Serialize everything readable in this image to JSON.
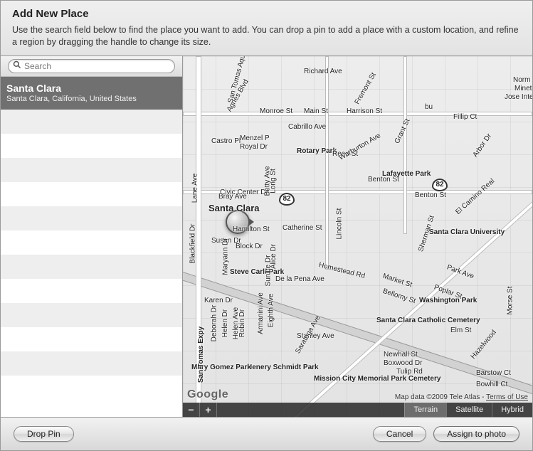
{
  "header": {
    "title": "Add New Place",
    "subtitle": "Use the search field below to find the place you want to add. You can drop a pin to add a place with a custom location, and refine a region by dragging the handle to change its size."
  },
  "search": {
    "placeholder": "Search",
    "value": ""
  },
  "results": [
    {
      "title": "Santa Clara",
      "subtitle": "Santa Clara, California, United States",
      "selected": true
    }
  ],
  "map": {
    "brand": "Google",
    "credit_text": "Map data ©2009 Tele Atlas - ",
    "terms_label": "Terms of Use",
    "zoom_out": "−",
    "zoom_in": "+",
    "types": [
      {
        "label": "Terrain",
        "active": true
      },
      {
        "label": "Satellite",
        "active": false
      },
      {
        "label": "Hybrid",
        "active": false
      }
    ],
    "shields": {
      "hwy_82a": "82",
      "hwy_82b": "82"
    },
    "labels": {
      "santa_clara": "Santa Clara",
      "monroe_st": "Monroe St",
      "main_st": "Main St",
      "richard_ave": "Richard Ave",
      "harrison_st": "Harrison St",
      "cabrillo_ave": "Cabrillo Ave",
      "castro_pl": "Castro Pl",
      "menzel_p": "Menzel P",
      "royal_dr": "Royal Dr",
      "rotary_park": "Rotary Park",
      "reed_st": "Reed St",
      "warburton_ave": "Warburton Ave",
      "benton_st_a": "Benton St",
      "benton_st_b": "Benton St",
      "lafayette_park": "Lafayette Park",
      "civic_center_dr": "Civic Center Dr",
      "catherine_st": "Catherine St",
      "hamilton_st": "Hamilton St",
      "susan_dr": "Susan Dr",
      "block_dr": "Block Dr",
      "bray_ave": "Bray Ave",
      "steve_carli_park": "Steve Carli Park",
      "karen_dr": "Karen Dr",
      "de_la_pena_ave": "De la Pena Ave",
      "homestead_rd": "Homestead Rd",
      "market_st": "Market St",
      "bellomy_st": "Bellomy St",
      "park_ave": "Park Ave",
      "poplar_st": "Poplar St",
      "scc_cemetery": "Santa Clara Catholic Cemetery",
      "washington_park": "Washington Park",
      "scu": "Santa Clara University",
      "henery_schmidt": "Henery Schmidt Park",
      "mary_gomez": "Mary Gomez Park",
      "mission_city": "Mission City Memorial Park Cemetery",
      "newhall_st": "Newhall St",
      "boxwood_dr": "Boxwood Dr",
      "tulip_rd": "Tulip Rd",
      "elm_st": "Elm St",
      "hazelwood": "Hazelwood",
      "stanley_ave": "Stanley Ave",
      "lincoln_st": "Lincoln St",
      "saratoga_ave": "Saratoga Ave",
      "alice_dr": "Alice Dr",
      "sunlite_dr": "Sunlite Dr",
      "eighth_ave": "Eighth Ave",
      "armanini_ave": "Armanini Ave",
      "maryann_dr": "Maryann Dr",
      "deborah_dr": "Deborah Dr",
      "helen_dr": "Helen Dr",
      "helen_ave": "Helen Ave",
      "robin_dr": "Robin Dr",
      "agnes_blvd": "Agnes Blvd",
      "long_st": "Long St",
      "betty_ave": "Betty Ave",
      "lane_ave": "Lane Ave",
      "blackfield_dr": "Blackfield Dr",
      "san_tomas_expy": "San Tomas Expy",
      "san_tomas_aq": "San Tomas Aquino",
      "grant_st": "Grant St",
      "fillip_ct": "Fillip Ct",
      "sherman_st": "Sherman St",
      "el_camino": "El Camino Real",
      "morse_st": "Morse St",
      "fremont_st": "Fremont St",
      "arbor_dr": "Arbor Dr",
      "barstow_ct": "Barstow Ct",
      "bowhill_ct": "Bowhill Ct",
      "norm": "Norm",
      "minet": "Minet",
      "jose_int": "Jose Inte",
      "fifth_st": "bu"
    }
  },
  "footer": {
    "drop_pin": "Drop Pin",
    "cancel": "Cancel",
    "assign": "Assign to photo"
  }
}
